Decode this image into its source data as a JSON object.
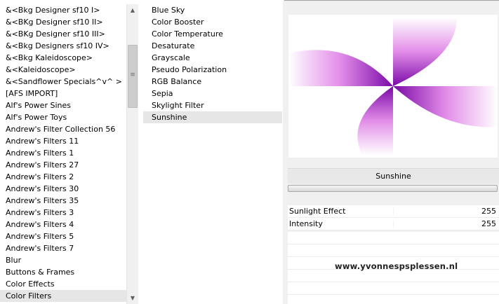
{
  "categories": {
    "items": [
      "&<Bkg Designer sf10 I>",
      "&<BKg Designer sf10 II>",
      "&<BKg Designer sf10 III>",
      "&<Bkg Designers sf10 IV>",
      "&<Bkg Kaleidoscope>",
      "&<Kaleidoscope>",
      "&<Sandflower Specials^v^ >",
      "[AFS IMPORT]",
      "Alf's Power Sines",
      "Alf's Power Toys",
      "Andrew's Filter Collection 56",
      "Andrew's Filters 11",
      "Andrew's Filters 1",
      "Andrew's Filters 27",
      "Andrew's Filters 2",
      "Andrew's Filters 30",
      "Andrew's Filters 35",
      "Andrew's Filters 3",
      "Andrew's Filters 4",
      "Andrew's Filters 5",
      "Andrew's Filters 7",
      "Blur",
      "Buttons & Frames",
      "Color Effects",
      "Color Filters"
    ],
    "selected": "Color Filters"
  },
  "scrollbar": {
    "up_icon": "triangle-up",
    "down_icon": "triangle-down",
    "grip_icon": "grip-lines",
    "up_glyph": "▲",
    "down_glyph": "▼",
    "grip_glyph": "≡"
  },
  "filters": {
    "items": [
      "Blue Sky",
      "Color Booster",
      "Color Temperature",
      "Desaturate",
      "Grayscale",
      "Pseudo Polarization",
      "RGB Balance",
      "Sepia",
      "Skylight Filter",
      "Sunshine"
    ],
    "selected": "Sunshine"
  },
  "panel": {
    "filter_name": "Sunshine",
    "progress": 0,
    "params": [
      {
        "label": "Sunlight Effect",
        "value": "255"
      },
      {
        "label": "Intensity",
        "value": "255"
      }
    ],
    "watermark": "www.yvonnespsplessen.nl"
  },
  "colors": {
    "preview_accent": "#a020c8",
    "preview_light": "#f4b6f4",
    "selection": "#e6e6e6",
    "panel_bg": "#f0f0f0"
  }
}
